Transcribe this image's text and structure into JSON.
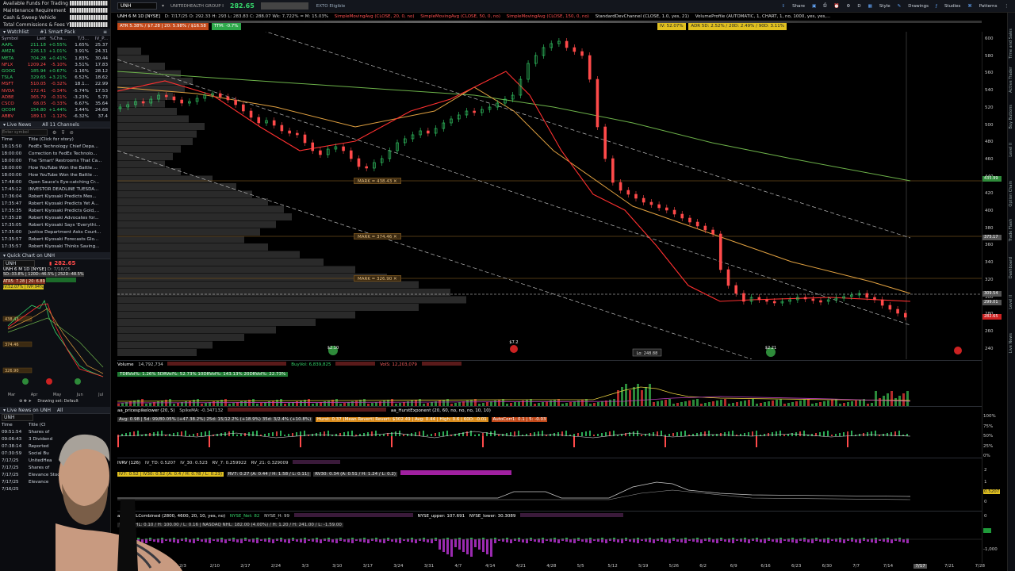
{
  "account": {
    "rows": [
      "Available Funds For Trading",
      "Maintenance Requirement",
      "Cash & Sweep Vehicle",
      "Total Commissions & Fees YTD"
    ]
  },
  "watchlist": {
    "header": "Watchlist",
    "list_name": "#1 Smart Pack",
    "columns": [
      "Symbol",
      "Last",
      "%Cha...",
      "T/3...",
      "IV_P..."
    ],
    "rows": [
      {
        "sym": "AAPL",
        "last": "211.18",
        "chg": "+0.55%",
        "c3": "1.65%",
        "c4": "25.37",
        "dir": "up"
      },
      {
        "sym": "AMZN",
        "last": "226.13",
        "chg": "+1.01%",
        "c3": "3.91%",
        "c4": "24.31",
        "dir": "up"
      },
      {
        "sym": "META",
        "last": "704.28",
        "chg": "+0.41%",
        "c3": "1.83%",
        "c4": "30.44",
        "dir": "up"
      },
      {
        "sym": "NFLX",
        "last": "1209.24",
        "chg": "-5.10%",
        "c3": "3.51%",
        "c4": "17.83",
        "dir": "dn"
      },
      {
        "sym": "GOOG",
        "last": "185.94",
        "chg": "+0.67%",
        "c3": "-1.16%",
        "c4": "28.12",
        "dir": "up"
      },
      {
        "sym": "TSLA",
        "last": "329.65",
        "chg": "+3.21%",
        "c3": "6.52%",
        "c4": "18.62",
        "dir": "up"
      },
      {
        "sym": "MSFT",
        "last": "510.05",
        "chg": "-0.32%",
        "c3": "18.1...",
        "c4": "22.99",
        "dir": "dn"
      },
      {
        "sym": "NVDA",
        "last": "172.41",
        "chg": "-0.34%",
        "c3": "-5.74%",
        "c4": "17.53",
        "dir": "dn"
      },
      {
        "sym": "ADBE",
        "last": "365.79",
        "chg": "-0.31%",
        "c3": "-3.23%",
        "c4": "5.73",
        "dir": "dn"
      },
      {
        "sym": "CSCO",
        "last": "68.05",
        "chg": "-0.33%",
        "c3": "6.67%",
        "c4": "35.64",
        "dir": "dn"
      },
      {
        "sym": "QCOM",
        "last": "154.80",
        "chg": "+1.44%",
        "c3": "3.44%",
        "c4": "24.68",
        "dir": "up"
      },
      {
        "sym": "ABBV",
        "last": "189.13",
        "chg": "-1.12%",
        "c3": "-6.32%",
        "c4": "37.4",
        "dir": "dn"
      }
    ]
  },
  "news": {
    "header": "Live News",
    "channel": "All 11 Channels",
    "search_placeholder": "Enter symbol",
    "col_time": "Time",
    "col_title": "Title (Click for story)",
    "rows": [
      {
        "t": "18:15:50",
        "title": "FedEx Technology Chief Depa..."
      },
      {
        "t": "18:00:00",
        "title": "Correction to FedEx Technolo..."
      },
      {
        "t": "18:00:00",
        "title": "The 'Smart' Restrooms That Ca..."
      },
      {
        "t": "18:00:00",
        "title": "How YouTube Won the Battle ..."
      },
      {
        "t": "18:00:00",
        "title": "How YouTube Won the Battle ..."
      },
      {
        "t": "17:48:00",
        "title": "Open Sauce's Eye-catching Cr..."
      },
      {
        "t": "17:45:12",
        "title": "INVESTOR DEADLINE TUESDA..."
      },
      {
        "t": "17:36:04",
        "title": "Robert Kiyosaki Predicts Mes..."
      },
      {
        "t": "17:35:47",
        "title": "Robert Kiyosaki Predicts Yet A..."
      },
      {
        "t": "17:35:35",
        "title": "Robert Kiyosaki Predicts Gold,..."
      },
      {
        "t": "17:35:28",
        "title": "Robert Kiyosaki Advocates for..."
      },
      {
        "t": "17:35:05",
        "title": "Robert Kiyosaki Says 'Everythi..."
      },
      {
        "t": "17:35:00",
        "title": "Justice Department Asks Court..."
      },
      {
        "t": "17:35:57",
        "title": "Robert Kiyosaki Forecasts Glo..."
      },
      {
        "t": "17:35:57",
        "title": "Robert Kiyosaki Thinks Saving..."
      }
    ]
  },
  "quick_chart": {
    "header": "Quick Chart on UNH",
    "symbol": "UNH",
    "price": "282.65",
    "title": "UNH 6 M 1D [NYSE]",
    "date_info": "D: 7/18/25",
    "pct_info": "5D:-33.8% | 120D:-46.5% | 252D:-48.5%",
    "atr": "ATR5: 7.28 | 20: 6.89",
    "ivp": "IV:52.07% | IVP:94%",
    "mark1": "438.43",
    "mark2": "374.46",
    "mark3": "326.90",
    "months": [
      "Mar",
      "Apr",
      "May",
      "Jun",
      "Jul"
    ],
    "drawing_set": "Drawing set: Default"
  },
  "news2": {
    "header": "Live News on UNH",
    "tab": "All",
    "symbol": "UNH",
    "col_time": "Time",
    "col_title": "Title (Cl",
    "rows": [
      {
        "t": "09:51:54",
        "title": "Shares of"
      },
      {
        "t": "09:06:43",
        "title": "3 Dividend"
      },
      {
        "t": "07:38:14",
        "title": "Reported"
      },
      {
        "t": "07:30:59",
        "title": "Social Bu"
      },
      {
        "t": "7/17/25",
        "title": "UnitedHea"
      },
      {
        "t": "7/17/25",
        "title": "Shares of"
      },
      {
        "t": "7/17/25",
        "title": "Elevance Stoc"
      },
      {
        "t": "7/17/25",
        "title": "Elevance"
      },
      {
        "t": "7/16/25",
        "title": ""
      }
    ]
  },
  "topbar": {
    "symbol": "UNH",
    "name": "UNITEDHEALTH GROUP I",
    "price": "282.65",
    "eligible": "EXTO Eligible",
    "share": "Share",
    "style": "Style",
    "drawings": "Drawings",
    "studies": "Studies",
    "patterns": "Patterns"
  },
  "studies_line": {
    "title": "UNH 6 M 1D [NYSE]",
    "ohlc": "D: 7/17/25   O: 292.33   H: 293   L: 283.83   C: 288.07   Wk: 7,722% = M: 15.03%",
    "sma1": "SimpleMovingAvg (CLOSE, 20, 0, no)",
    "sma2": "SimpleMovingAvg (CLOSE, 50, 0, no)",
    "sma3": "SimpleMovingAvg (CLOSE, 150, 0, no)",
    "stddev": "StandardDevChannel (CLOSE, 1.0, yes, 21)",
    "vprofile": "VolumeProfile (AUTOMATIC, 1, CHART, 1, no, 1000, yes, yes,..."
  },
  "sub_info": {
    "atr": "ATR 5.38% / $7.28 | 20: 5.98% / $16.58",
    "ttm": "TTM: -0.7%",
    "iv": "IV: 52.07%",
    "adr": "ADR 5D: 2.52% / 20D: 2.49% / 90D: 3.11%"
  },
  "price_axis": {
    "labels": [
      "600",
      "580",
      "560",
      "540",
      "520",
      "500",
      "480",
      "460",
      "440",
      "420",
      "400",
      "380",
      "360",
      "340",
      "320",
      "300",
      "280",
      "260",
      "240"
    ],
    "tags": [
      {
        "val": "435.99",
        "color": "#2e8b3a"
      },
      {
        "val": "375.17",
        "color": "#555"
      },
      {
        "val": "309.54",
        "color": "#555"
      },
      {
        "val": "299.01",
        "color": "#555"
      },
      {
        "val": "282.65",
        "color": "#c22"
      }
    ]
  },
  "marks": [
    {
      "label": "MARK = 438.43"
    },
    {
      "label": "MARK = 374.46"
    },
    {
      "label": "MARK = 326.90"
    }
  ],
  "low_label": "Lo: 248.88",
  "event_labels": {
    "e1": "$2.10",
    "e2": "$7.2",
    "e3": "$2.21"
  },
  "panels": {
    "volume": {
      "title": "Volume",
      "value": "14,792,734",
      "extra": "BuyVol: 6,839,825",
      "extra2": "VolS: 12,203,079"
    },
    "rv": {
      "text": "TDRVol%: 1.26%   5DRVol%: 52.73%   10DRVol%: 143.13%   20DRVol%: 22.73%"
    },
    "hurst": {
      "title": "aa_pricespikelower (20, 5)",
      "spike": "SpikeMA: -0.347132",
      "exponent": "aa_HurstExponent (20, 60, no, no, no, 10, 10)",
      "line2": "Avg: 0.98 | 5d: 99/80.05% (+47.38.2%)   25d: 15/12.2% (+18.9%)   35d: 3/2.4% (+10.8%)",
      "hurst": "Hurst: 0.37 (Mean Revert) Revert: $302.49 | Avg: 0.44 | High: 0.6 | 60D: -0.01",
      "autocorr": "AutoCorr1: 0.1 | 5: -0.03"
    },
    "ivrv": {
      "title": "IVRV (126)",
      "iv": "IV_TD: 0.5207",
      "iv30": "IV_30: 0.523",
      "rv7": "RV_7: 0.259922",
      "rv21": "RV_21: 0.329009",
      "line2": "IV7: 0.52 | IV30: 0.52 (A: 0.4 / H: 0.78 / L: 0.23)",
      "rv7b": "RV7: 0.27 (A: 0.44 / H: 1.58 / L: 0.11)",
      "rv30": "RV30: 0.34 (A: 0.51 / H: 1.24 / L: 0.2)",
      "axis": [
        "2",
        "1",
        "0.5207",
        "0"
      ]
    },
    "breadth": {
      "title": "aa_NetHLCombined (2800, 4600, 20, 10, yes, no)",
      "nyse_net": "NYSE_Net: 82",
      "nyse_h": "NYSE_H: 99",
      "nyse_upper": "NYSE_upper: 107.691",
      "nyse_lower": "NYSE_lower: 30.3089",
      "line2": "NYSE NHL: 0.10 / H: 100.00 / L: 0.16 | NASDAQ NHL: 182.00 (4.00%) / H: 1.20 / H: 241.00 / L: -1.59.00",
      "axis": [
        "0",
        "-1,000"
      ]
    },
    "pct_axis": [
      "100%",
      "75%",
      "50%",
      "25%",
      "0%"
    ]
  },
  "dates": [
    "2/3",
    "2/10",
    "2/17",
    "2/24",
    "3/3",
    "3/10",
    "3/17",
    "3/24",
    "3/31",
    "4/7",
    "4/14",
    "4/21",
    "4/28",
    "5/5",
    "5/12",
    "5/19",
    "5/26",
    "6/2",
    "6/9",
    "6/16",
    "6/23",
    "6/30",
    "7/7",
    "7/14",
    "7/17",
    "7/21",
    "7/28"
  ],
  "right_rail": [
    "Time and Sales",
    "Active Trader",
    "Buy Buttons",
    "Level II",
    "Option Chain",
    "Trade Flash",
    "Dashboard",
    "Level II",
    "Live News"
  ],
  "colors": {
    "bg": "#000000",
    "up": "#35d46a",
    "down": "#ff4a4a",
    "sma20": "#ff3030",
    "sma50": "#e0a040",
    "sma150": "#6db34a",
    "mark": "#e8a040"
  }
}
